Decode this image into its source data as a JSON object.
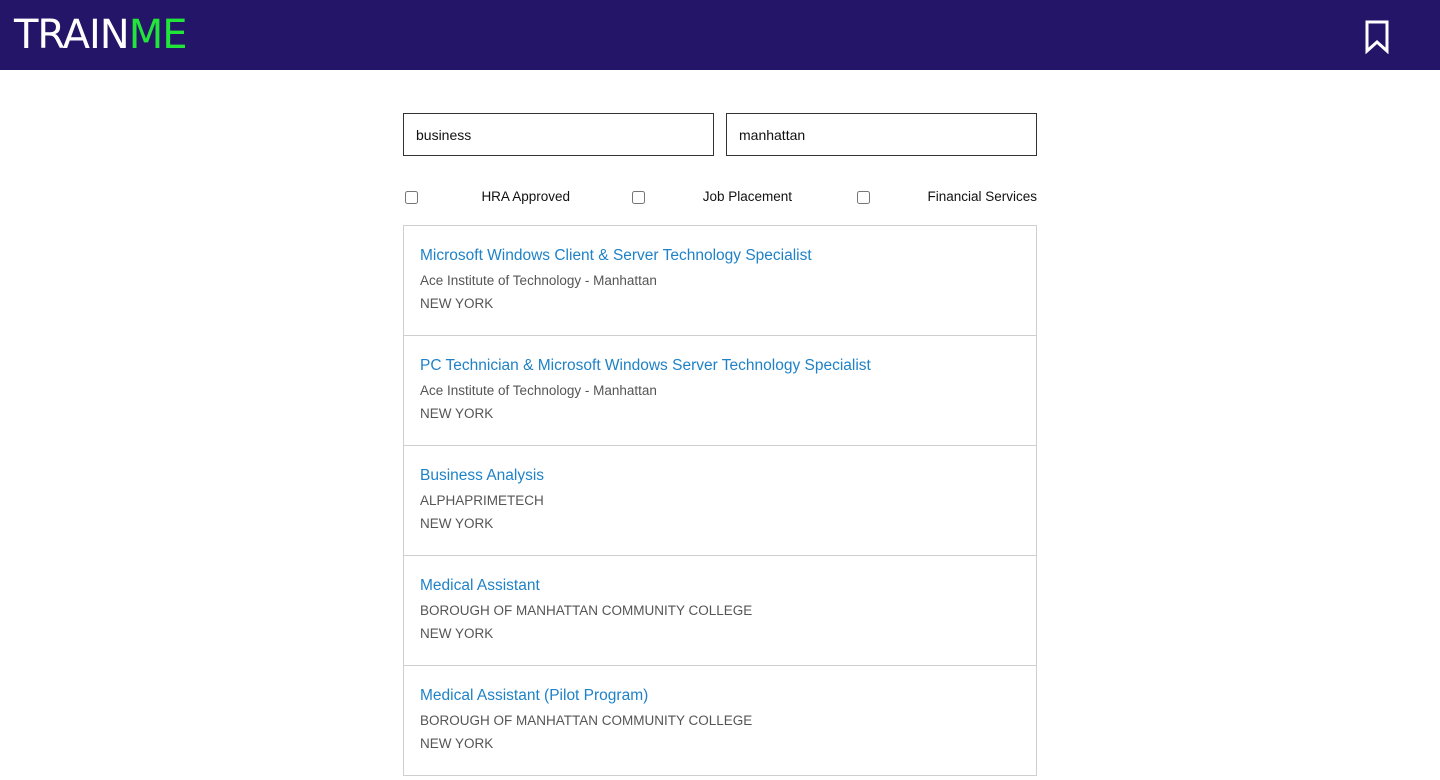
{
  "header": {
    "logo_part_a": "TRAIN",
    "logo_part_b": "ME",
    "logo_accent_color": "#22e53a",
    "background_color": "#251568",
    "bookmark_icon": "bookmark-icon"
  },
  "search": {
    "query_value": "business",
    "location_value": "manhattan"
  },
  "filters": [
    {
      "label": "HRA Approved",
      "checked": false
    },
    {
      "label": "Job Placement",
      "checked": false
    },
    {
      "label": "Financial Services",
      "checked": false
    }
  ],
  "results": [
    {
      "title": "Microsoft Windows Client & Server Technology Specialist",
      "provider": "Ace Institute of Technology - Manhattan",
      "city": "NEW YORK"
    },
    {
      "title": "PC Technician & Microsoft Windows Server Technology Specialist",
      "provider": "Ace Institute of Technology - Manhattan",
      "city": "NEW YORK"
    },
    {
      "title": "Business Analysis",
      "provider": "ALPHAPRIMETECH",
      "city": "NEW YORK"
    },
    {
      "title": "Medical Assistant",
      "provider": "BOROUGH OF MANHATTAN COMMUNITY COLLEGE",
      "city": "NEW YORK"
    },
    {
      "title": "Medical Assistant (Pilot Program)",
      "provider": "BOROUGH OF MANHATTAN COMMUNITY COLLEGE",
      "city": "NEW YORK"
    }
  ],
  "colors": {
    "link": "#1f82c7",
    "secondary_text": "#555555",
    "border": "#cfcfcf"
  }
}
